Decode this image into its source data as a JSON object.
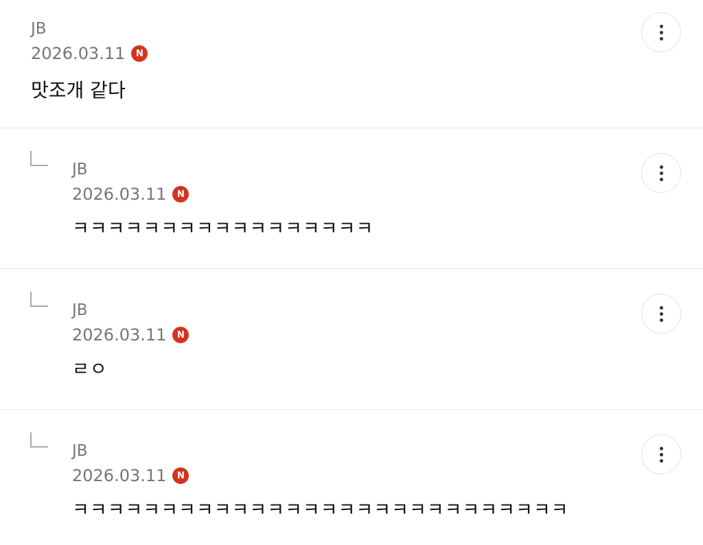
{
  "comments": [
    {
      "author": "JB",
      "date": "2026.03.11",
      "badge": "N",
      "text": "맛조개 같다",
      "is_reply": false,
      "menu_icon": "more-vertical-icon"
    },
    {
      "author": "JB",
      "date": "2026.03.11",
      "badge": "N",
      "text": "ㅋㅋㅋㅋㅋㅋㅋㅋㅋㅋㅋㅋㅋㅋㅋㅋㅋ",
      "is_reply": true,
      "menu_icon": "more-vertical-icon"
    },
    {
      "author": "JB",
      "date": "2026.03.11",
      "badge": "N",
      "text": "ㄹㅇ",
      "is_reply": true,
      "menu_icon": "more-vertical-icon"
    },
    {
      "author": "JB",
      "date": "2026.03.11",
      "badge": "N",
      "text": "ㅋㅋㅋㅋㅋㅋㅋㅋㅋㅋㅋㅋㅋㅋㅋㅋㅋㅋㅋㅋㅋㅋㅋㅋㅋㅋㅋㅋ",
      "is_reply": true,
      "menu_icon": "more-vertical-icon"
    }
  ],
  "colors": {
    "new_badge": "#d6321e",
    "meta_text": "#767676",
    "body_text": "#111111",
    "divider": "#e6e6e6"
  }
}
